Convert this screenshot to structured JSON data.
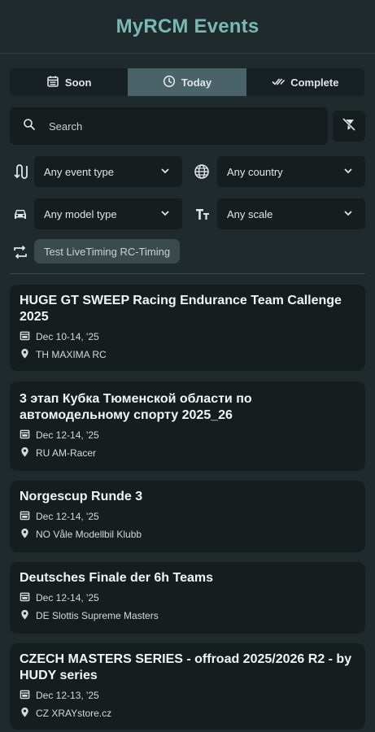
{
  "app": {
    "title": "MyRCM Events"
  },
  "tabs": [
    {
      "label": "Soon",
      "icon": "calendar-icon",
      "active": false
    },
    {
      "label": "Today",
      "icon": "clock-icon",
      "active": true
    },
    {
      "label": "Complete",
      "icon": "double-check-icon",
      "active": false
    }
  ],
  "search": {
    "placeholder": "Search",
    "value": ""
  },
  "filters": {
    "event_type": "Any event type",
    "country": "Any country",
    "model_type": "Any model type",
    "scale": "Any scale",
    "timing_chip": "Test LiveTiming RC-Timing"
  },
  "events": [
    {
      "title": "HUGE GT SWEEP Racing Endurance Team Callenge 2025",
      "date": "Dec 10-14, '25",
      "location": "TH MAXIMA RC"
    },
    {
      "title": "3 этап Кубка Тюменской области по автомодельному спорту 2025_26",
      "date": "Dec 12-14, '25",
      "location": "RU AM-Racer"
    },
    {
      "title": "Norgescup Runde 3",
      "date": "Dec 12-14, '25",
      "location": "NO Våle Modellbil Klubb"
    },
    {
      "title": "Deutsches Finale der 6h Teams",
      "date": "Dec 12-14, '25",
      "location": "DE Slottis Supreme Masters"
    },
    {
      "title": "CZECH MASTERS SERIES - offroad 2025/2026 R2 - by HUDY series",
      "date": "Dec 12-13, '25",
      "location": "CZ XRAYstore.cz"
    }
  ],
  "colors": {
    "background": "#1f2a2d",
    "accent": "#79b8b3",
    "active_tab": "#4a6368",
    "card": "#151d1f"
  }
}
